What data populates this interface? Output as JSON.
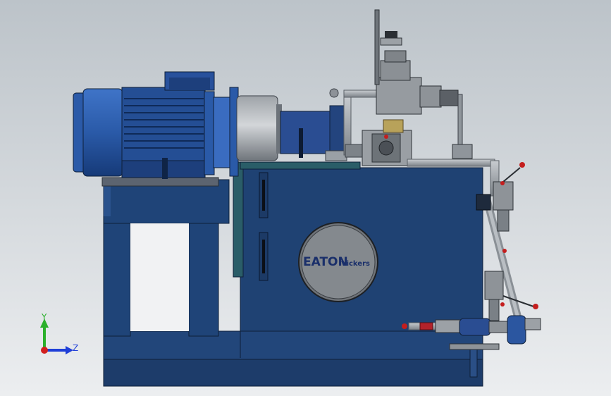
{
  "logo": {
    "brand": "EATON",
    "product": "Vickers"
  },
  "triad": {
    "y_label": "Y",
    "z_label": "Z",
    "y_color": "#2bb02b",
    "z_color": "#1f3fd8",
    "origin_color": "#d22020"
  },
  "colors": {
    "background_top": "#bfc6cc",
    "background_bottom": "#e8eaec",
    "frame_blue": "#1f3f6e",
    "motor_blue": "#2a5aa8",
    "tank_blue": "#1e3f70",
    "steel": "#9aa0a6",
    "handle_red": "#c41e1e"
  }
}
